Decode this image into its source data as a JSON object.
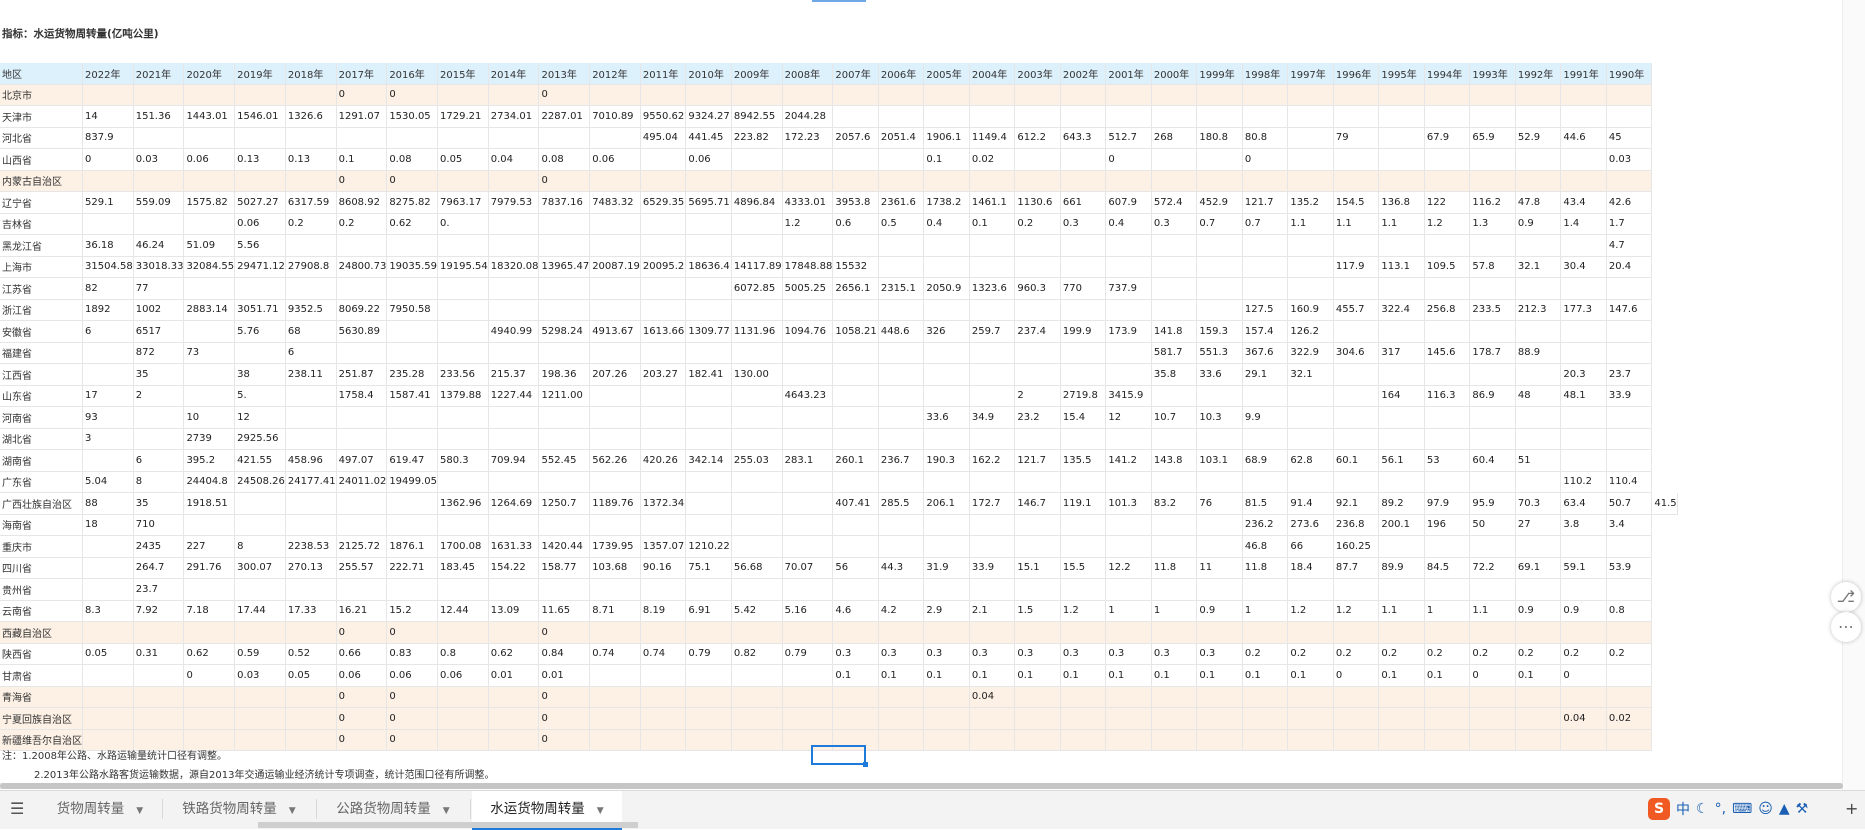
{
  "sheet": {
    "title": "指标：水运货物周转量(亿吨公里)",
    "header": [
      "地区",
      "2022年",
      "2021年",
      "2020年",
      "2019年",
      "2018年",
      "2017年",
      "2016年",
      "2015年",
      "2014年",
      "2013年",
      "2012年",
      "2011年",
      "2010年",
      "2009年",
      "2008年",
      "2007年",
      "2006年",
      "2005年",
      "2004年",
      "2003年",
      "2002年",
      "2001年",
      "2000年",
      "1999年",
      "1998年",
      "1997年",
      "1996年",
      "1995年",
      "1994年",
      "1993年",
      "1992年",
      "1991年",
      "1990年"
    ],
    "rows": [
      [
        "北京市",
        "",
        "",
        "",
        "",
        "",
        "0",
        "0",
        "",
        "",
        "0",
        "",
        "",
        "",
        "",
        "",
        "",
        "",
        "",
        "",
        "",
        "",
        "",
        "",
        "",
        "",
        "",
        "",
        "",
        "",
        "",
        "",
        "",
        ""
      ],
      [
        "天津市",
        "14",
        "151.36",
        "1443.01",
        "1546.01",
        "1326.6",
        "1291.07",
        "1530.05",
        "1729.21",
        "2734.01",
        "2287.01",
        "7010.89",
        "9550.62",
        "9324.27",
        "8942.55",
        "2044.28",
        "",
        "",
        "",
        "",
        "",
        "",
        "",
        "",
        "",
        "",
        "",
        "",
        "",
        "",
        "",
        "",
        "",
        ""
      ],
      [
        "河北省",
        "837.9",
        "",
        "",
        "",
        "",
        "",
        "",
        "",
        "",
        "",
        "",
        "495.04",
        "441.45",
        "223.82",
        "172.23",
        "2057.6",
        "2051.4",
        "1906.1",
        "1149.4",
        "612.2",
        "643.3",
        "512.7",
        "268",
        "180.8",
        "80.8",
        "",
        "79",
        "",
        "67.9",
        "65.9",
        "52.9",
        "44.6",
        "45"
      ],
      [
        "山西省",
        "0",
        "0.03",
        "0.06",
        "0.13",
        "0.13",
        "0.1",
        "0.08",
        "0.05",
        "0.04",
        "0.08",
        "0.06",
        "",
        "0.06",
        "",
        "",
        "",
        "",
        "0.1",
        "0.02",
        "",
        "",
        "0",
        "",
        "",
        "0",
        "",
        "",
        "",
        "",
        "",
        "",
        "",
        "0.03"
      ],
      [
        "内蒙古自治区",
        "",
        "",
        "",
        "",
        "",
        "0",
        "0",
        "",
        "",
        "0",
        "",
        "",
        "",
        "",
        "",
        "",
        "",
        "",
        "",
        "",
        "",
        "",
        "",
        "",
        "",
        "",
        "",
        "",
        "",
        "",
        "",
        "",
        ""
      ],
      [
        "辽宁省",
        "529.1",
        "559.09",
        "1575.82",
        "5027.27",
        "6317.59",
        "8608.92",
        "8275.82",
        "7963.17",
        "7979.53",
        "7837.16",
        "7483.32",
        "6529.35",
        "5695.71",
        "4896.84",
        "4333.01",
        "3953.8",
        "2361.6",
        "1738.2",
        "1461.1",
        "1130.6",
        "661",
        "607.9",
        "572.4",
        "452.9",
        "121.7",
        "135.2",
        "154.5",
        "136.8",
        "122",
        "116.2",
        "47.8",
        "43.4",
        "42.6"
      ],
      [
        "吉林省",
        "",
        "",
        "",
        "0.06",
        "0.2",
        "0.2",
        "0.62",
        "0.",
        "",
        "",
        "",
        "",
        "",
        "",
        "1.2",
        "0.6",
        "0.5",
        "0.4",
        "0.1",
        "0.2",
        "0.3",
        "0.4",
        "0.3",
        "0.7",
        "0.7",
        "1.1",
        "1.1",
        "1.1",
        "1.2",
        "1.3",
        "0.9",
        "1.4",
        "1.7"
      ],
      [
        "黑龙江省",
        "36.18",
        "46.24",
        "51.09",
        "5.56",
        "",
        "",
        "",
        "",
        "",
        "",
        "",
        "",
        "",
        "",
        "",
        "",
        "",
        "",
        "",
        "",
        "",
        "",
        "",
        "",
        "",
        "",
        "",
        "",
        "",
        "",
        "",
        "",
        "4.7"
      ],
      [
        "上海市",
        "31504.58",
        "33018.33",
        "32084.55",
        "29471.12",
        "27908.8",
        "24800.73",
        "19035.59",
        "19195.54",
        "18320.08",
        "13965.47",
        "20087.19",
        "20095.2",
        "18636.4",
        "14117.89",
        "17848.88",
        "15532",
        "",
        "",
        "",
        "",
        "",
        "",
        "",
        "",
        "",
        "",
        "117.9",
        "113.1",
        "109.5",
        "57.8",
        "32.1",
        "30.4",
        "20.4"
      ],
      [
        "江苏省",
        "82",
        "77",
        "",
        "",
        "",
        "",
        "",
        "",
        "",
        "",
        "",
        "",
        "",
        "6072.85",
        "5005.25",
        "2656.1",
        "2315.1",
        "2050.9",
        "1323.6",
        "960.3",
        "770",
        "737.9",
        "",
        "",
        "",
        "",
        "",
        "",
        "",
        "",
        "",
        "",
        ""
      ],
      [
        "浙江省",
        "1892",
        "1002",
        "2883.14",
        "3051.71",
        "9352.5",
        "8069.22",
        "7950.58",
        "",
        "",
        "",
        "",
        "",
        "",
        "",
        "",
        "",
        "",
        "",
        "",
        "",
        "",
        "",
        "",
        "",
        "127.5",
        "160.9",
        "455.7",
        "322.4",
        "256.8",
        "233.5",
        "212.3",
        "177.3",
        "147.6"
      ],
      [
        "安徽省",
        "6",
        "6517",
        "",
        "5.76",
        "68",
        "5630.89",
        "",
        "",
        "4940.99",
        "5298.24",
        "4913.67",
        "1613.66",
        "1309.77",
        "1131.96",
        "1094.76",
        "1058.21",
        "448.6",
        "326",
        "259.7",
        "237.4",
        "199.9",
        "173.9",
        "141.8",
        "159.3",
        "157.4",
        "126.2",
        "",
        "",
        "",
        "",
        "",
        "",
        ""
      ],
      [
        "福建省",
        "",
        "872",
        "73",
        "",
        "6",
        "",
        "",
        "",
        "",
        "",
        "",
        "",
        "",
        "",
        "",
        "",
        "",
        "",
        "",
        "",
        "",
        "",
        "581.7",
        "551.3",
        "367.6",
        "322.9",
        "304.6",
        "317",
        "145.6",
        "178.7",
        "88.9",
        "",
        ""
      ],
      [
        "江西省",
        "",
        "35",
        "",
        "38",
        "238.11",
        "251.87",
        "235.28",
        "233.56",
        "215.37",
        "198.36",
        "207.26",
        "203.27",
        "182.41",
        "130.00",
        "",
        "",
        "",
        "",
        "",
        "",
        "",
        "",
        "35.8",
        "33.6",
        "29.1",
        "32.1",
        "",
        "",
        "",
        "",
        "",
        "20.3",
        "23.7"
      ],
      [
        "山东省",
        "17",
        "2",
        "",
        "5.",
        "",
        "1758.4",
        "1587.41",
        "1379.88",
        "1227.44",
        "1211.00",
        "",
        "",
        "",
        "",
        "4643.23",
        "",
        "",
        "",
        "",
        "2",
        "2719.8",
        "3415.9",
        "",
        "",
        "",
        "",
        "",
        "164",
        "116.3",
        "86.9",
        "48",
        "48.1",
        "33.9"
      ],
      [
        "河南省",
        "93",
        "",
        "10",
        "12",
        "",
        "",
        "",
        "",
        "",
        "",
        "",
        "",
        "",
        "",
        "",
        "",
        "",
        "33.6",
        "34.9",
        "23.2",
        "15.4",
        "12",
        "10.7",
        "10.3",
        "9.9",
        "",
        "",
        "",
        "",
        "",
        "",
        "",
        ""
      ],
      [
        "湖北省",
        "3",
        "",
        "2739",
        "2925.56",
        "",
        "",
        "",
        "",
        "",
        "",
        "",
        "",
        "",
        "",
        "",
        "",
        "",
        "",
        "",
        "",
        "",
        "",
        "",
        "",
        "",
        "",
        "",
        "",
        "",
        "",
        "",
        "",
        ""
      ],
      [
        "湖南省",
        "",
        "6",
        "395.2",
        "421.55",
        "458.96",
        "497.07",
        "619.47",
        "580.3",
        "709.94",
        "552.45",
        "562.26",
        "420.26",
        "342.14",
        "255.03",
        "283.1",
        "260.1",
        "236.7",
        "190.3",
        "162.2",
        "121.7",
        "135.5",
        "141.2",
        "143.8",
        "103.1",
        "68.9",
        "62.8",
        "60.1",
        "56.1",
        "53",
        "60.4",
        "51",
        "",
        ""
      ],
      [
        "广东省",
        "5.04",
        "8",
        "24404.8",
        "24508.26",
        "24177.41",
        "24011.02",
        "19499.05",
        "",
        "",
        "",
        "",
        "",
        "",
        "",
        "",
        "",
        "",
        "",
        "",
        "",
        "",
        "",
        "",
        "",
        "",
        "",
        "",
        "",
        "",
        "",
        "",
        "110.2",
        "110.4"
      ],
      [
        "广西壮族自治区",
        "88",
        "35",
        "1918.51",
        "",
        "",
        "",
        "",
        "1362.96",
        "1264.69",
        "1250.7",
        "1189.76",
        "1372.34",
        "",
        "",
        "",
        "407.41",
        "285.5",
        "206.1",
        "172.7",
        "146.7",
        "119.1",
        "101.3",
        "83.2",
        "76",
        "81.5",
        "91.4",
        "92.1",
        "89.2",
        "97.9",
        "95.9",
        "70.3",
        "63.4",
        "50.7",
        "41.5"
      ],
      [
        "海南省",
        "18",
        "710",
        "",
        "",
        "",
        "",
        "",
        "",
        "",
        "",
        "",
        "",
        "",
        "",
        "",
        "",
        "",
        "",
        "",
        "",
        "",
        "",
        "",
        "",
        "236.2",
        "273.6",
        "236.8",
        "200.1",
        "196",
        "50",
        "27",
        "3.8",
        "3.4"
      ],
      [
        "重庆市",
        "",
        "2435",
        "227",
        "8",
        "2238.53",
        "2125.72",
        "1876.1",
        "1700.08",
        "1631.33",
        "1420.44",
        "1739.95",
        "1357.07",
        "1210.22",
        "",
        "",
        "",
        "",
        "",
        "",
        "",
        "",
        "",
        "",
        "",
        "46.8",
        "66",
        "160.25",
        "",
        "",
        "",
        "",
        "",
        ""
      ],
      [
        "四川省",
        "",
        "264.7",
        "291.76",
        "300.07",
        "270.13",
        "255.57",
        "222.71",
        "183.45",
        "154.22",
        "158.77",
        "103.68",
        "90.16",
        "75.1",
        "56.68",
        "70.07",
        "56",
        "44.3",
        "31.9",
        "33.9",
        "15.1",
        "15.5",
        "12.2",
        "11.8",
        "11",
        "11.8",
        "18.4",
        "87.7",
        "89.9",
        "84.5",
        "72.2",
        "69.1",
        "59.1",
        "53.9"
      ],
      [
        "贵州省",
        "",
        "23.7",
        "",
        "",
        "",
        "",
        "",
        "",
        "",
        "",
        "",
        "",
        "",
        "",
        "",
        "",
        "",
        "",
        "",
        "",
        "",
        "",
        "",
        "",
        "",
        "",
        "",
        "",
        "",
        "",
        "",
        "",
        ""
      ],
      [
        "云南省",
        "8.3",
        "7.92",
        "7.18",
        "17.44",
        "17.33",
        "16.21",
        "15.2",
        "12.44",
        "13.09",
        "11.65",
        "8.71",
        "8.19",
        "6.91",
        "5.42",
        "5.16",
        "4.6",
        "4.2",
        "2.9",
        "2.1",
        "1.5",
        "1.2",
        "1",
        "1",
        "0.9",
        "1",
        "1.2",
        "1.2",
        "1.1",
        "1",
        "1.1",
        "0.9",
        "0.9",
        "0.8"
      ],
      [
        "西藏自治区",
        "",
        "",
        "",
        "",
        "",
        "0",
        "0",
        "",
        "",
        "0",
        "",
        "",
        "",
        "",
        "",
        "",
        "",
        "",
        "",
        "",
        "",
        "",
        "",
        "",
        "",
        "",
        "",
        "",
        "",
        "",
        "",
        "",
        ""
      ],
      [
        "陕西省",
        "0.05",
        "0.31",
        "0.62",
        "0.59",
        "0.52",
        "0.66",
        "0.83",
        "0.8",
        "0.62",
        "0.84",
        "0.74",
        "0.74",
        "0.79",
        "0.82",
        "0.79",
        "0.3",
        "0.3",
        "0.3",
        "0.3",
        "0.3",
        "0.3",
        "0.3",
        "0.3",
        "0.3",
        "0.2",
        "0.2",
        "0.2",
        "0.2",
        "0.2",
        "0.2",
        "0.2",
        "0.2",
        "0.2"
      ],
      [
        "甘肃省",
        "",
        "",
        "0",
        "0.03",
        "0.05",
        "0.06",
        "0.06",
        "0.06",
        "0.01",
        "0.01",
        "",
        "",
        "",
        "",
        "",
        "0.1",
        "0.1",
        "0.1",
        "0.1",
        "0.1",
        "0.1",
        "0.1",
        "0.1",
        "0.1",
        "0.1",
        "0.1",
        "0",
        "0.1",
        "0.1",
        "0",
        "0.1",
        "0",
        ""
      ],
      [
        "青海省",
        "",
        "",
        "",
        "",
        "",
        "0",
        "0",
        "",
        "",
        "0",
        "",
        "",
        "",
        "",
        "",
        "",
        "",
        "",
        "0.04",
        "",
        "",
        "",
        "",
        "",
        "",
        "",
        "",
        "",
        "",
        "",
        "",
        "",
        ""
      ],
      [
        "宁夏回族自治区",
        "",
        "",
        "",
        "",
        "",
        "0",
        "0",
        "",
        "",
        "0",
        "",
        "",
        "",
        "",
        "",
        "",
        "",
        "",
        "",
        "",
        "",
        "",
        "",
        "",
        "",
        "",
        "",
        "",
        "",
        "",
        "",
        "0.04",
        "0.02"
      ],
      [
        "新疆维吾尔自治区",
        "",
        "",
        "",
        "",
        "",
        "0",
        "0",
        "",
        "",
        "0",
        "",
        "",
        "",
        "",
        "",
        "",
        "",
        "",
        "",
        "",
        "",
        "",
        "",
        "",
        "",
        "",
        "",
        "",
        "",
        "",
        "",
        "",
        ""
      ]
    ],
    "notes": [
      "注：1.2008年公路、水路运输量统计口径有调整。",
      "2.2013年公路水路客货运输数据，源自2013年交通运输业经济统计专项调查，统计范围口径有所调整。"
    ]
  },
  "tabs": [
    {
      "label": "货物周转量"
    },
    {
      "label": "铁路货物周转量"
    },
    {
      "label": "公路货物周转量"
    },
    {
      "label": "水运货物周转量"
    }
  ],
  "tab_arrow": "▼",
  "ime": {
    "logo": "S",
    "lang": "中"
  },
  "colors": {
    "header_bg": "#ddf1fc",
    "alt_row_bg": "#fdf1e6",
    "accent": "#1e7bdc"
  }
}
